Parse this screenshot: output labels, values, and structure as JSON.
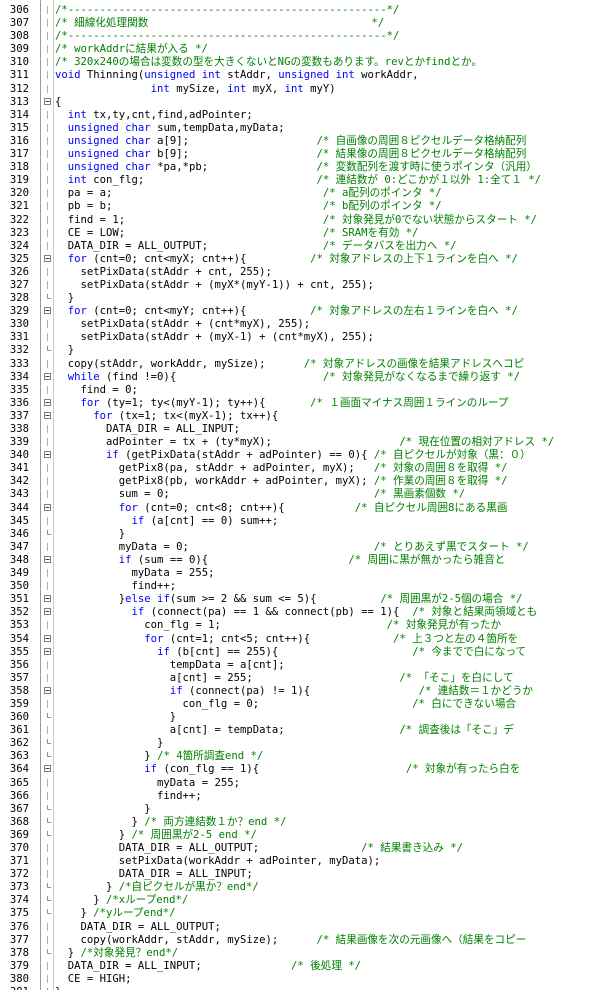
{
  "lines": [
    {
      "n": "306",
      "fold": "line",
      "segments": [
        {
          "t": "/*--------------------------------------------------*/",
          "c": "com"
        }
      ]
    },
    {
      "n": "307",
      "fold": "line",
      "segments": [
        {
          "t": "/* 細線化処理関数                                   */",
          "c": "com"
        }
      ]
    },
    {
      "n": "308",
      "fold": "line",
      "segments": [
        {
          "t": "/*--------------------------------------------------*/",
          "c": "com"
        }
      ]
    },
    {
      "n": "309",
      "fold": "line",
      "segments": [
        {
          "t": "/* workAddrに結果が入る */",
          "c": "com"
        }
      ]
    },
    {
      "n": "310",
      "fold": "line",
      "segments": [
        {
          "t": "/* 320x240の場合は変数の型を大きくないとNGの変数もあります。revとかfindとか。",
          "c": "com"
        }
      ]
    },
    {
      "n": "311",
      "fold": "line",
      "segments": [
        {
          "t": "void ",
          "c": "kw"
        },
        {
          "t": "Thinning(",
          "c": "def"
        },
        {
          "t": "unsigned int",
          "c": "typ"
        },
        {
          "t": " stAddr, ",
          "c": "def"
        },
        {
          "t": "unsigned int",
          "c": "typ"
        },
        {
          "t": " workAddr,",
          "c": "def"
        }
      ]
    },
    {
      "n": "312",
      "fold": "line",
      "segments": [
        {
          "t": "               ",
          "c": "def"
        },
        {
          "t": "int",
          "c": "typ"
        },
        {
          "t": " mySize, ",
          "c": "def"
        },
        {
          "t": "int",
          "c": "typ"
        },
        {
          "t": " myX, ",
          "c": "def"
        },
        {
          "t": "int",
          "c": "typ"
        },
        {
          "t": " myY)",
          "c": "def"
        }
      ]
    },
    {
      "n": "313",
      "fold": "box",
      "segments": [
        {
          "t": "{",
          "c": "def"
        }
      ]
    },
    {
      "n": "314",
      "fold": "line",
      "segments": [
        {
          "t": "  ",
          "c": "def"
        },
        {
          "t": "int",
          "c": "typ"
        },
        {
          "t": " tx,ty,cnt,find,adPointer;",
          "c": "def"
        }
      ]
    },
    {
      "n": "315",
      "fold": "line",
      "segments": [
        {
          "t": "  ",
          "c": "def"
        },
        {
          "t": "unsigned char",
          "c": "typ"
        },
        {
          "t": " sum,tempData,myData;",
          "c": "def"
        }
      ]
    },
    {
      "n": "316",
      "fold": "line",
      "segments": [
        {
          "t": "  ",
          "c": "def"
        },
        {
          "t": "unsigned char",
          "c": "typ"
        },
        {
          "t": " a[9];                    ",
          "c": "def"
        },
        {
          "t": "/* 自画像の周囲８ピクセルデータ格納配列",
          "c": "com"
        }
      ]
    },
    {
      "n": "317",
      "fold": "line",
      "segments": [
        {
          "t": "  ",
          "c": "def"
        },
        {
          "t": "unsigned char",
          "c": "typ"
        },
        {
          "t": " b[9];                    ",
          "c": "def"
        },
        {
          "t": "/* 結果像の周囲８ピクセルデータ格納配列",
          "c": "com"
        }
      ]
    },
    {
      "n": "318",
      "fold": "line",
      "segments": [
        {
          "t": "  ",
          "c": "def"
        },
        {
          "t": "unsigned char",
          "c": "typ"
        },
        {
          "t": " *pa,*pb;                 ",
          "c": "def"
        },
        {
          "t": "/* 変数配列を渡す時に使うポインタ（汎用）",
          "c": "com"
        }
      ]
    },
    {
      "n": "319",
      "fold": "line",
      "segments": [
        {
          "t": "  ",
          "c": "def"
        },
        {
          "t": "int",
          "c": "typ"
        },
        {
          "t": " con_flg;                           ",
          "c": "def"
        },
        {
          "t": "/* 連結数が 0:どこかが１以外 1:全て１ */",
          "c": "com"
        }
      ]
    },
    {
      "n": "320",
      "fold": "line",
      "segments": [
        {
          "t": "  pa = a;                                 ",
          "c": "def"
        },
        {
          "t": "/* a配列のポインタ */",
          "c": "com"
        }
      ]
    },
    {
      "n": "321",
      "fold": "line",
      "segments": [
        {
          "t": "  pb = b;                                 ",
          "c": "def"
        },
        {
          "t": "/* b配列のポインタ */",
          "c": "com"
        }
      ]
    },
    {
      "n": "322",
      "fold": "line",
      "segments": [
        {
          "t": "  find = 1;                               ",
          "c": "def"
        },
        {
          "t": "/* 対象発見が0でない状態からスタート */",
          "c": "com"
        }
      ]
    },
    {
      "n": "323",
      "fold": "line",
      "segments": [
        {
          "t": "  CE = LOW;                               ",
          "c": "def"
        },
        {
          "t": "/* SRAMを有効 */",
          "c": "com"
        }
      ]
    },
    {
      "n": "324",
      "fold": "line",
      "segments": [
        {
          "t": "  DATA_DIR = ALL_OUTPUT;                  ",
          "c": "def"
        },
        {
          "t": "/* データバスを出力へ */",
          "c": "com"
        }
      ]
    },
    {
      "n": "325",
      "fold": "box",
      "segments": [
        {
          "t": "  ",
          "c": "def"
        },
        {
          "t": "for",
          "c": "kw"
        },
        {
          "t": " (cnt=0; cnt<myX; cnt++){          ",
          "c": "def"
        },
        {
          "t": "/* 対象アドレスの上下１ラインを白へ */",
          "c": "com"
        }
      ]
    },
    {
      "n": "326",
      "fold": "line",
      "segments": [
        {
          "t": "    setPixData(stAddr + cnt, 255);",
          "c": "def"
        }
      ]
    },
    {
      "n": "327",
      "fold": "line",
      "segments": [
        {
          "t": "    setPixData(stAddr + (myX*(myY-1)) + cnt, 255);",
          "c": "def"
        }
      ]
    },
    {
      "n": "328",
      "fold": "end",
      "segments": [
        {
          "t": "  }",
          "c": "def"
        }
      ]
    },
    {
      "n": "329",
      "fold": "box",
      "segments": [
        {
          "t": "  ",
          "c": "def"
        },
        {
          "t": "for",
          "c": "kw"
        },
        {
          "t": " (cnt=0; cnt<myY; cnt++){          ",
          "c": "def"
        },
        {
          "t": "/* 対象アドレスの左右１ラインを白へ */",
          "c": "com"
        }
      ]
    },
    {
      "n": "330",
      "fold": "line",
      "segments": [
        {
          "t": "    setPixData(stAddr + (cnt*myX), 255);",
          "c": "def"
        }
      ]
    },
    {
      "n": "331",
      "fold": "line",
      "segments": [
        {
          "t": "    setPixData(stAddr + (myX-1) + (cnt*myX), 255);",
          "c": "def"
        }
      ]
    },
    {
      "n": "332",
      "fold": "end",
      "segments": [
        {
          "t": "  }",
          "c": "def"
        }
      ]
    },
    {
      "n": "333",
      "fold": "line",
      "segments": [
        {
          "t": "  copy(stAddr, workAddr, mySize);      ",
          "c": "def"
        },
        {
          "t": "/* 対象アドレスの画像を結果アドレスへコピ",
          "c": "com"
        }
      ]
    },
    {
      "n": "334",
      "fold": "box",
      "segments": [
        {
          "t": "  ",
          "c": "def"
        },
        {
          "t": "while",
          "c": "kw"
        },
        {
          "t": " (find !=0){                       ",
          "c": "def"
        },
        {
          "t": "/* 対象発見がなくなるまで繰り返す */",
          "c": "com"
        }
      ]
    },
    {
      "n": "335",
      "fold": "line",
      "segments": [
        {
          "t": "    find = 0;",
          "c": "def"
        }
      ]
    },
    {
      "n": "336",
      "fold": "box",
      "segments": [
        {
          "t": "    ",
          "c": "def"
        },
        {
          "t": "for",
          "c": "kw"
        },
        {
          "t": " (ty=1; ty<(myY-1); ty++){       ",
          "c": "def"
        },
        {
          "t": "/* １画面マイナス周囲１ラインのループ",
          "c": "com"
        }
      ]
    },
    {
      "n": "337",
      "fold": "box",
      "segments": [
        {
          "t": "      ",
          "c": "def"
        },
        {
          "t": "for",
          "c": "kw"
        },
        {
          "t": " (tx=1; tx<(myX-1); tx++){",
          "c": "def"
        }
      ]
    },
    {
      "n": "338",
      "fold": "line",
      "segments": [
        {
          "t": "        DATA_DIR = ALL_INPUT;",
          "c": "def"
        }
      ]
    },
    {
      "n": "339",
      "fold": "line",
      "segments": [
        {
          "t": "        adPointer = tx + (ty*myX);                    ",
          "c": "def"
        },
        {
          "t": "/* 現在位置の相対アドレス */",
          "c": "com"
        }
      ]
    },
    {
      "n": "340",
      "fold": "box",
      "segments": [
        {
          "t": "        ",
          "c": "def"
        },
        {
          "t": "if",
          "c": "kw"
        },
        {
          "t": " (getPixData(stAddr + adPointer) == 0){ ",
          "c": "def"
        },
        {
          "t": "/* 自ピクセルが対象（黒：０）",
          "c": "com"
        }
      ]
    },
    {
      "n": "341",
      "fold": "line",
      "segments": [
        {
          "t": "          getPix8(pa, stAddr + adPointer, myX);   ",
          "c": "def"
        },
        {
          "t": "/* 対象の周囲８を取得 */",
          "c": "com"
        }
      ]
    },
    {
      "n": "342",
      "fold": "line",
      "segments": [
        {
          "t": "          getPix8(pb, workAddr + adPointer, myX); ",
          "c": "def"
        },
        {
          "t": "/* 作業の周囲８を取得 */",
          "c": "com"
        }
      ]
    },
    {
      "n": "343",
      "fold": "line",
      "segments": [
        {
          "t": "          sum = 0;                                ",
          "c": "def"
        },
        {
          "t": "/* 黒画素個数 */",
          "c": "com"
        }
      ]
    },
    {
      "n": "344",
      "fold": "box",
      "segments": [
        {
          "t": "          ",
          "c": "def"
        },
        {
          "t": "for",
          "c": "kw"
        },
        {
          "t": " (cnt=0; cnt<8; cnt++){           ",
          "c": "def"
        },
        {
          "t": "/* 自ピクセル周囲8にある黒画",
          "c": "com"
        }
      ]
    },
    {
      "n": "345",
      "fold": "line",
      "segments": [
        {
          "t": "            ",
          "c": "def"
        },
        {
          "t": "if",
          "c": "kw"
        },
        {
          "t": " (a[cnt] == 0) sum++;",
          "c": "def"
        }
      ]
    },
    {
      "n": "346",
      "fold": "end",
      "segments": [
        {
          "t": "          }",
          "c": "def"
        }
      ]
    },
    {
      "n": "347",
      "fold": "line",
      "segments": [
        {
          "t": "          myData = 0;                             ",
          "c": "def"
        },
        {
          "t": "/* とりあえず黒でスタート */",
          "c": "com"
        }
      ]
    },
    {
      "n": "348",
      "fold": "box",
      "segments": [
        {
          "t": "          ",
          "c": "def"
        },
        {
          "t": "if",
          "c": "kw"
        },
        {
          "t": " (sum == 0){                      ",
          "c": "def"
        },
        {
          "t": "/* 周囲に黒が無かったら雑音と",
          "c": "com"
        }
      ]
    },
    {
      "n": "349",
      "fold": "line",
      "segments": [
        {
          "t": "            myData = 255;",
          "c": "def"
        }
      ]
    },
    {
      "n": "350",
      "fold": "line",
      "segments": [
        {
          "t": "            find++;",
          "c": "def"
        }
      ]
    },
    {
      "n": "351",
      "fold": "box",
      "segments": [
        {
          "t": "          }",
          "c": "def"
        },
        {
          "t": "else if",
          "c": "kw"
        },
        {
          "t": "(sum >= 2 && sum <= 5){          ",
          "c": "def"
        },
        {
          "t": "/* 周囲黒が2-5個の場合 */",
          "c": "com"
        }
      ]
    },
    {
      "n": "352",
      "fold": "box",
      "segments": [
        {
          "t": "            ",
          "c": "def"
        },
        {
          "t": "if",
          "c": "kw"
        },
        {
          "t": " (connect(pa) == 1 && connect(pb) == 1){  ",
          "c": "def"
        },
        {
          "t": "/* 対象と結果両領域とも",
          "c": "com"
        }
      ]
    },
    {
      "n": "353",
      "fold": "line",
      "segments": [
        {
          "t": "              con_flg = 1;                          ",
          "c": "def"
        },
        {
          "t": "/* 対象発見が有ったか",
          "c": "com"
        }
      ]
    },
    {
      "n": "354",
      "fold": "box",
      "segments": [
        {
          "t": "              ",
          "c": "def"
        },
        {
          "t": "for",
          "c": "kw"
        },
        {
          "t": " (cnt=1; cnt<5; cnt++){             ",
          "c": "def"
        },
        {
          "t": "/* 上３つと左の４箇所を",
          "c": "com"
        }
      ]
    },
    {
      "n": "355",
      "fold": "box",
      "segments": [
        {
          "t": "                ",
          "c": "def"
        },
        {
          "t": "if",
          "c": "kw"
        },
        {
          "t": " (b[cnt] == 255){                     ",
          "c": "def"
        },
        {
          "t": "/* 今までで白になって",
          "c": "com"
        }
      ]
    },
    {
      "n": "356",
      "fold": "line",
      "segments": [
        {
          "t": "                  tempData = a[cnt];",
          "c": "def"
        }
      ]
    },
    {
      "n": "357",
      "fold": "line",
      "segments": [
        {
          "t": "                  a[cnt] = 255;                       ",
          "c": "def"
        },
        {
          "t": "/* 「そこ」を白にして",
          "c": "com"
        }
      ]
    },
    {
      "n": "358",
      "fold": "box",
      "segments": [
        {
          "t": "                  ",
          "c": "def"
        },
        {
          "t": "if",
          "c": "kw"
        },
        {
          "t": " (connect(pa) != 1){                 ",
          "c": "def"
        },
        {
          "t": "/* 連結数＝１かどうか",
          "c": "com"
        }
      ]
    },
    {
      "n": "359",
      "fold": "line",
      "segments": [
        {
          "t": "                    con_flg = 0;                        ",
          "c": "def"
        },
        {
          "t": "/* 白にできない場合",
          "c": "com"
        }
      ]
    },
    {
      "n": "360",
      "fold": "end",
      "segments": [
        {
          "t": "                  }",
          "c": "def"
        }
      ]
    },
    {
      "n": "361",
      "fold": "line",
      "segments": [
        {
          "t": "                  a[cnt] = tempData;                  ",
          "c": "def"
        },
        {
          "t": "/* 調査後は「そこ」デ",
          "c": "com"
        }
      ]
    },
    {
      "n": "362",
      "fold": "end",
      "segments": [
        {
          "t": "                }",
          "c": "def"
        }
      ]
    },
    {
      "n": "363",
      "fold": "end",
      "segments": [
        {
          "t": "              } ",
          "c": "def"
        },
        {
          "t": "/* 4箇所調査end */",
          "c": "com"
        }
      ]
    },
    {
      "n": "364",
      "fold": "box",
      "segments": [
        {
          "t": "              ",
          "c": "def"
        },
        {
          "t": "if",
          "c": "kw"
        },
        {
          "t": " (con_flg == 1){                       ",
          "c": "def"
        },
        {
          "t": "/* 対象が有ったら白を",
          "c": "com"
        }
      ]
    },
    {
      "n": "365",
      "fold": "line",
      "segments": [
        {
          "t": "                myData = 255;",
          "c": "def"
        }
      ]
    },
    {
      "n": "366",
      "fold": "line",
      "segments": [
        {
          "t": "                find++;",
          "c": "def"
        }
      ]
    },
    {
      "n": "367",
      "fold": "end",
      "segments": [
        {
          "t": "              }",
          "c": "def"
        }
      ]
    },
    {
      "n": "368",
      "fold": "end",
      "segments": [
        {
          "t": "            } ",
          "c": "def"
        },
        {
          "t": "/* 両方連結数１か？end */",
          "c": "com"
        }
      ]
    },
    {
      "n": "369",
      "fold": "end",
      "segments": [
        {
          "t": "          } ",
          "c": "def"
        },
        {
          "t": "/* 周囲黒が2-5 end */",
          "c": "com"
        }
      ]
    },
    {
      "n": "370",
      "fold": "line",
      "segments": [
        {
          "t": "          DATA_DIR = ALL_OUTPUT;                ",
          "c": "def"
        },
        {
          "t": "/* 結果書き込み */",
          "c": "com"
        }
      ]
    },
    {
      "n": "371",
      "fold": "line",
      "segments": [
        {
          "t": "          setPixData(workAddr + adPointer, myData);",
          "c": "def"
        }
      ]
    },
    {
      "n": "372",
      "fold": "line",
      "segments": [
        {
          "t": "          DATA_DIR = ALL_INPUT;",
          "c": "def"
        }
      ]
    },
    {
      "n": "373",
      "fold": "end",
      "segments": [
        {
          "t": "        } ",
          "c": "def"
        },
        {
          "t": "/*自ピクセルが黒か？end*/",
          "c": "com"
        }
      ]
    },
    {
      "n": "374",
      "fold": "end",
      "segments": [
        {
          "t": "      } ",
          "c": "def"
        },
        {
          "t": "/*xループend*/",
          "c": "com"
        }
      ]
    },
    {
      "n": "375",
      "fold": "end",
      "segments": [
        {
          "t": "    } ",
          "c": "def"
        },
        {
          "t": "/*yループend*/",
          "c": "com"
        }
      ]
    },
    {
      "n": "376",
      "fold": "line",
      "segments": [
        {
          "t": "    DATA_DIR = ALL_OUTPUT;",
          "c": "def"
        }
      ]
    },
    {
      "n": "377",
      "fold": "line",
      "segments": [
        {
          "t": "    copy(workAddr, stAddr, mySize);      ",
          "c": "def"
        },
        {
          "t": "/* 結果画像を次の元画像へ（結果をコピー",
          "c": "com"
        }
      ]
    },
    {
      "n": "378",
      "fold": "end",
      "segments": [
        {
          "t": "  } ",
          "c": "def"
        },
        {
          "t": "/*対象発見？end*/",
          "c": "com"
        }
      ]
    },
    {
      "n": "379",
      "fold": "line",
      "segments": [
        {
          "t": "  DATA_DIR = ALL_INPUT;              ",
          "c": "def"
        },
        {
          "t": "/* 後処理 */",
          "c": "com"
        }
      ]
    },
    {
      "n": "380",
      "fold": "line",
      "segments": [
        {
          "t": "  CE = HIGH;",
          "c": "def"
        }
      ]
    },
    {
      "n": "381",
      "fold": "end",
      "segments": [
        {
          "t": "}",
          "c": "def"
        }
      ]
    }
  ]
}
